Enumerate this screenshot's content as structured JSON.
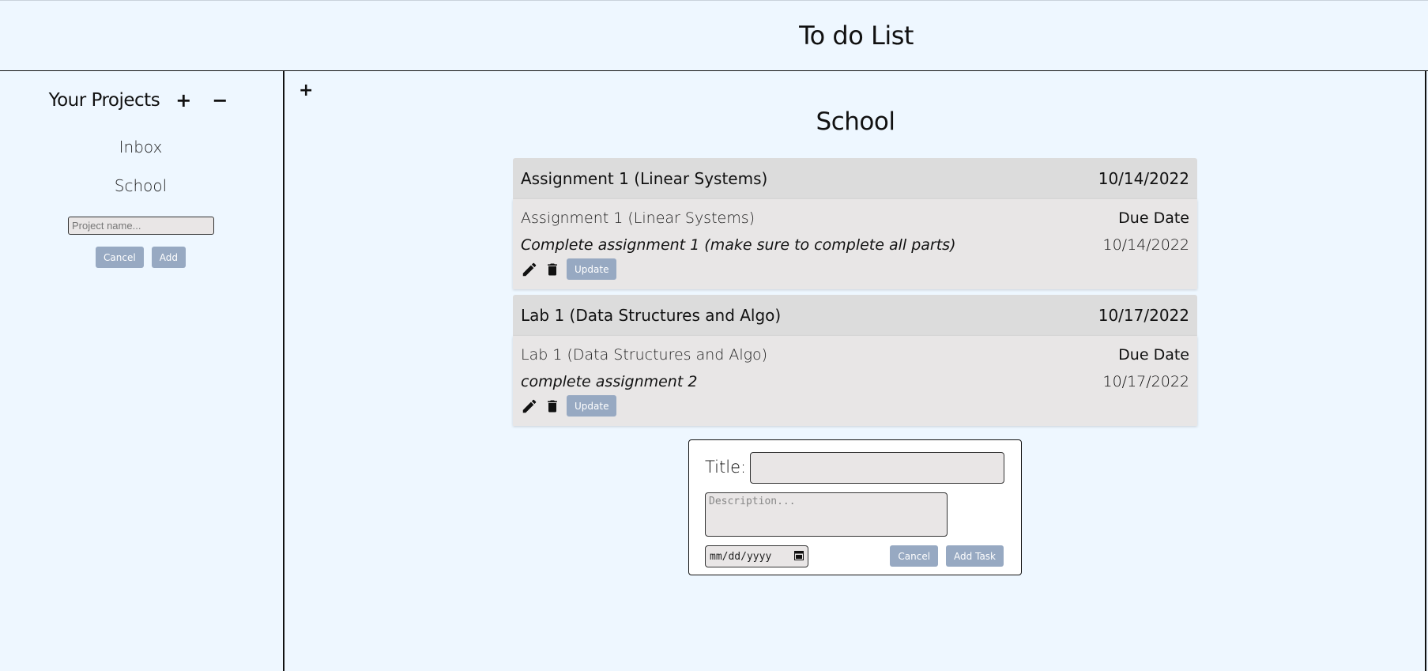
{
  "app": {
    "title": "To do List"
  },
  "sidebar": {
    "heading": "Your Projects",
    "add_icon": "+",
    "remove_icon": "−",
    "projects": [
      {
        "label": "Inbox"
      },
      {
        "label": "School"
      }
    ],
    "project_input": {
      "placeholder": "Project name...",
      "value": ""
    },
    "cancel_label": "Cancel",
    "add_label": "Add"
  },
  "main": {
    "add_icon": "+",
    "project_title": "School",
    "tasks": [
      {
        "header_title": "Assignment 1 (Linear Systems)",
        "header_date": "10/14/2022",
        "title": "Assignment 1 (Linear Systems)",
        "due_label": "Due Date",
        "description": "Complete assignment 1 (make sure to complete all parts)",
        "due_date": "10/14/2022",
        "edit_icon": "pencil-icon",
        "delete_icon": "trash-icon",
        "update_label": "Update"
      },
      {
        "header_title": "Lab 1 (Data Structures and Algo)",
        "header_date": "10/17/2022",
        "title": "Lab 1 (Data Structures and Algo)",
        "due_label": "Due Date",
        "description": "complete assignment 2",
        "due_date": "10/17/2022",
        "edit_icon": "pencil-icon",
        "delete_icon": "trash-icon",
        "update_label": "Update"
      }
    ],
    "new_task_form": {
      "title_label": "Title:",
      "title_value": "",
      "description_placeholder": "Description...",
      "date_placeholder": "mm/dd/yyyy",
      "cancel_label": "Cancel",
      "add_label": "Add Task"
    }
  },
  "colors": {
    "background": "#eef7ff",
    "button": "#97a9c2",
    "task_header": "#dcdcdc",
    "task_body": "#e8e6e6"
  }
}
